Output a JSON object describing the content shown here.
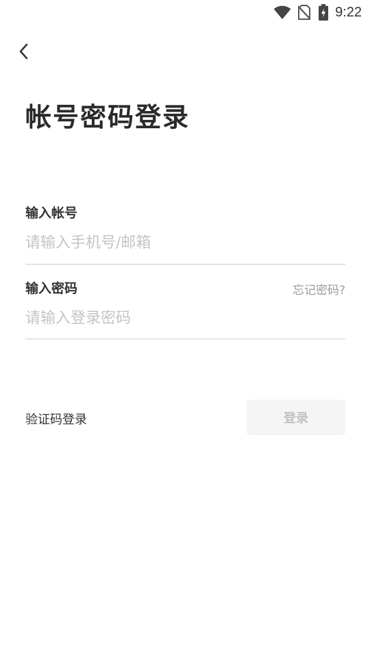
{
  "status_bar": {
    "time": "9:22",
    "icons": [
      "wifi-icon",
      "no-sim-icon",
      "battery-charging-icon"
    ]
  },
  "header": {
    "back_icon": "chevron-left-icon",
    "title": "帐号密码登录"
  },
  "form": {
    "account": {
      "label": "输入帐号",
      "placeholder": "请输入手机号/邮箱",
      "value": ""
    },
    "password": {
      "label": "输入密码",
      "placeholder": "请输入登录密码",
      "value": "",
      "forgot_label": "忘记密码?"
    }
  },
  "actions": {
    "sms_login_label": "验证码登录",
    "login_label": "登录"
  },
  "colors": {
    "background": "#ffffff",
    "text_primary": "#333333",
    "placeholder": "#c4c4c4",
    "divider": "#cfcfcf",
    "button_disabled_bg": "#f5f5f5",
    "button_disabled_text": "#c2c2c2"
  }
}
